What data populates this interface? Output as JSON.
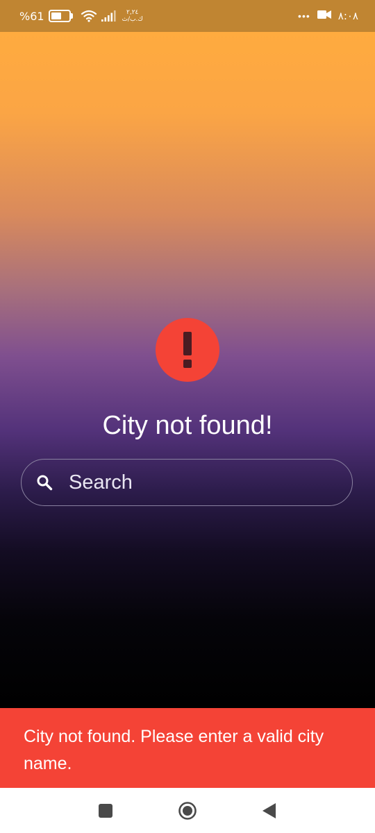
{
  "status_bar": {
    "battery_percent": "%61",
    "date_line1": "٢,٢٤",
    "date_line2": "ك.ب/ث",
    "time": "٨:٠٨",
    "icons": [
      "battery-icon",
      "wifi-icon",
      "signal-icon",
      "more-dots-icon",
      "video-camera-icon"
    ]
  },
  "error": {
    "icon": "exclamation-icon",
    "title": "City not found!"
  },
  "search": {
    "placeholder": "Search",
    "value": "",
    "icon": "search-icon"
  },
  "snackbar": {
    "message": "City not found. Please enter a valid city name."
  },
  "navigation_bar": {
    "buttons": [
      "recents-square-icon",
      "home-circle-icon",
      "back-triangle-icon"
    ]
  },
  "colors": {
    "status_bar": "#c08532",
    "gradient_top": "#ffab3f",
    "gradient_mid": "#53327a",
    "gradient_bottom": "#000000",
    "error_red": "#f44336"
  }
}
